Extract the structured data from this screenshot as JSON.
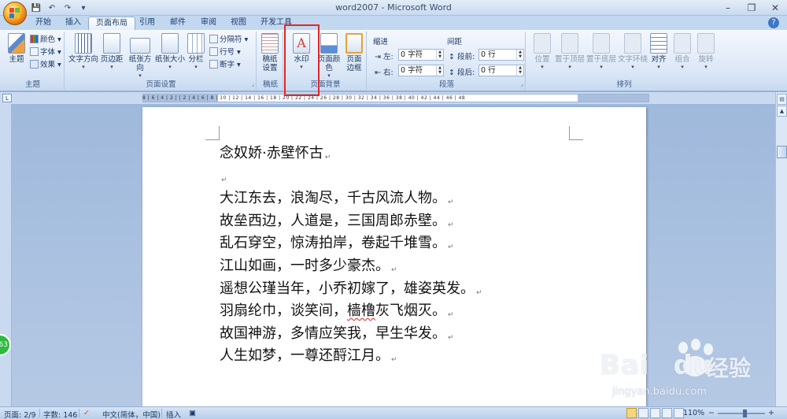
{
  "window": {
    "title": "word2007 - Microsoft Word",
    "minimize": "–",
    "restore": "❐",
    "close": "✕"
  },
  "qat": {
    "save": "💾",
    "undo": "↶",
    "redo": "↷",
    "more": "▾"
  },
  "tabs": [
    "开始",
    "插入",
    "页面布局",
    "引用",
    "邮件",
    "审阅",
    "视图",
    "开发工具"
  ],
  "active_tab": "页面布局",
  "help": "?",
  "ribbon": {
    "theme_group": {
      "label": "主题",
      "theme_btn": "主题",
      "colors": "颜色",
      "fonts": "字体",
      "effects": "效果"
    },
    "page_setup_group": {
      "label": "页面设置",
      "text_direction": "文字方向",
      "margins": "页边距",
      "orientation": "纸张方向",
      "size": "纸张大小",
      "columns": "分栏",
      "breaks": "分隔符",
      "line_numbers": "行号",
      "hyphenation": "断字"
    },
    "draft_group": {
      "label": "稿纸",
      "draft_setup": "稿纸设置"
    },
    "page_bg_group": {
      "label": "页面背景",
      "watermark": "水印",
      "page_color": "页面颜色",
      "page_borders": "页面边框"
    },
    "paragraph_group": {
      "label": "段落",
      "indent": "缩进",
      "spacing": "间距",
      "left_label": "左:",
      "right_label": "右:",
      "before_label": "段前:",
      "after_label": "段后:",
      "left_value": "0 字符",
      "right_value": "0 字符",
      "before_value": "0 行",
      "after_value": "0 行"
    },
    "arrange_group": {
      "label": "排列",
      "position": "位置",
      "bring_front": "置于顶层",
      "send_back": "置于底层",
      "text_wrap": "文字环绕",
      "align": "对齐",
      "group": "组合",
      "rotate": "旋转"
    }
  },
  "ruler": {
    "corner": "L",
    "ticks": "8 | 6 | 4 | 2 |   | 2 | 4 | 6 | 8 | 10 | 12 | 14 | 16 | 18 | 20 | 22 | 24 | 26 | 28 | 30 | 32 | 34 | 36 | 38 | 40 | 42 | 44 | 46 | 48"
  },
  "document": {
    "lines": [
      "念奴娇·赤壁怀古",
      "",
      "大江东去，浪淘尽，千古风流人物。",
      "故垒西边，人道是，三国周郎赤壁。",
      "乱石穿空，惊涛拍岸，卷起千堆雪。",
      "江山如画，一时多少豪杰。",
      "遥想公瑾当年，小乔初嫁了，雄姿英发。",
      "羽扇纶巾，谈笑间，",
      "故国神游，多情应笑我，早生华发。",
      "人生如梦，一尊还酹江月。"
    ],
    "squiggle_text": "樯橹",
    "line7_tail": "灰飞烟灭。",
    "para_mark": "↵"
  },
  "badge": {
    "text": "63"
  },
  "watermark": {
    "brand": "Bai",
    "brand2": "du",
    "cn": "经验",
    "url": "jingyan.baidu.com"
  },
  "status": {
    "page": "页面: 2/9",
    "words": "字数: 146",
    "language": "中文(简体，中国)",
    "insert": "插入",
    "zoom": "110%",
    "zoom_out": "−",
    "zoom_in": "+"
  }
}
